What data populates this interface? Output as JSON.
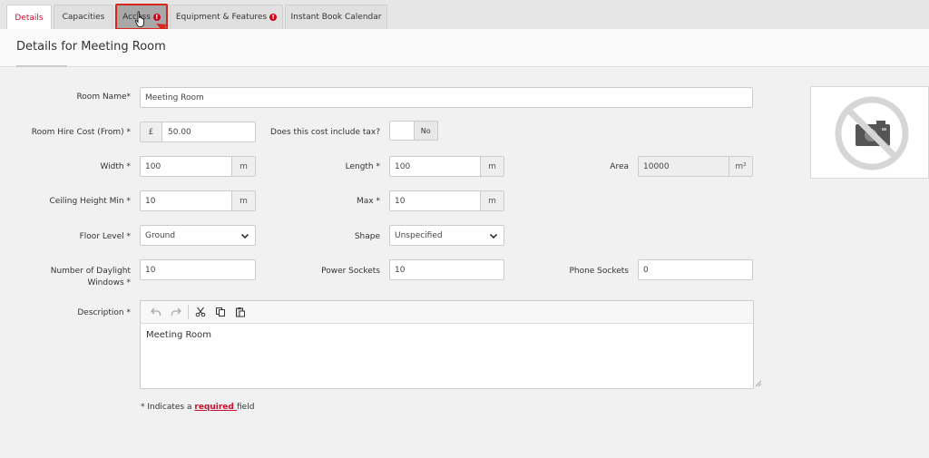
{
  "tabs": [
    {
      "label": "Details",
      "active": true
    },
    {
      "label": "Capacities"
    },
    {
      "label": "Access",
      "alert": true,
      "highlighted": true
    },
    {
      "label": "Equipment & Features",
      "alert": true
    },
    {
      "label": "Instant Book Calendar"
    }
  ],
  "alert_symbol": "!",
  "page_title": "Details for Meeting Room",
  "form": {
    "room_name": {
      "label": "Room Name*",
      "value": "Meeting Room"
    },
    "hire_cost": {
      "label": "Room Hire Cost (From) *",
      "prefix": "£",
      "value": "50.00"
    },
    "tax": {
      "label": "Does this cost include tax?",
      "value": "No"
    },
    "width": {
      "label": "Width *",
      "value": "100",
      "unit": "m"
    },
    "length": {
      "label": "Length *",
      "value": "100",
      "unit": "m"
    },
    "area": {
      "label": "Area",
      "value": "10000",
      "unit": "m²"
    },
    "ceiling_min": {
      "label": "Ceiling Height Min *",
      "value": "10",
      "unit": "m"
    },
    "ceiling_max": {
      "label": "Max *",
      "value": "10",
      "unit": "m"
    },
    "floor_level": {
      "label": "Floor Level *",
      "value": "Ground"
    },
    "shape": {
      "label": "Shape",
      "value": "Unspecified"
    },
    "daylight_windows": {
      "label_line1": "Number of Daylight",
      "label_line2": "Windows *",
      "value": "10"
    },
    "power_sockets": {
      "label": "Power Sockets",
      "value": "10"
    },
    "phone_sockets": {
      "label": "Phone Sockets",
      "value": "0"
    },
    "description": {
      "label": "Description *",
      "value": "Meeting Room"
    }
  },
  "required_note": {
    "prefix": "* Indicates a ",
    "link": "required ",
    "suffix": "field"
  },
  "colors": {
    "accent": "#c8102e",
    "highlight_border": "#d7261d",
    "alert": "#d0021b"
  },
  "icons": [
    "undo-icon",
    "redo-icon",
    "cut-icon",
    "copy-icon",
    "paste-icon",
    "no-photo-icon",
    "chevron-down-icon",
    "hand-cursor-icon"
  ]
}
